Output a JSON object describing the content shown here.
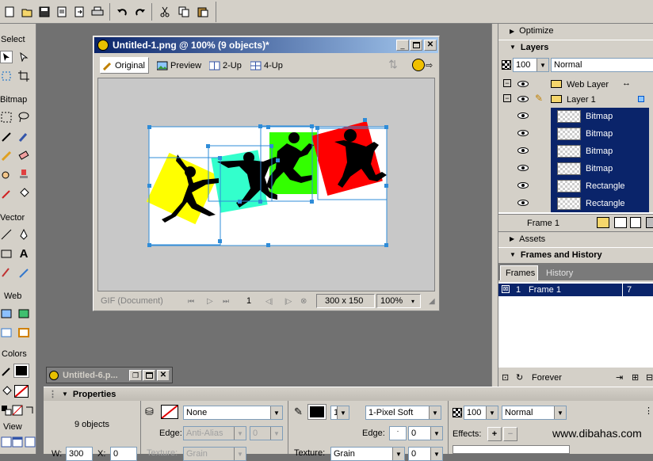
{
  "document": {
    "title": "Untitled-1.png @ 100% (9 objects)*",
    "view_tabs": [
      "Original",
      "Preview",
      "2-Up",
      "4-Up"
    ],
    "status_format": "GIF (Document)",
    "frame_number": "1",
    "dimensions": "300 x 150",
    "zoom": "100%"
  },
  "minimized_doc": {
    "title": "Untitled-6.p..."
  },
  "toolbox": {
    "sections": [
      "Select",
      "Bitmap",
      "Vector",
      "Web",
      "Colors",
      "View"
    ]
  },
  "right_panels": {
    "optimize_label": "Optimize",
    "layers_label": "Layers",
    "opacity": "100",
    "blend_mode": "Normal",
    "layers": [
      {
        "name": "Web Layer",
        "type": "layer"
      },
      {
        "name": "Layer 1",
        "type": "layer"
      },
      {
        "name": "Bitmap",
        "type": "object"
      },
      {
        "name": "Bitmap",
        "type": "object"
      },
      {
        "name": "Bitmap",
        "type": "object"
      },
      {
        "name": "Bitmap",
        "type": "object"
      },
      {
        "name": "Rectangle",
        "type": "object"
      },
      {
        "name": "Rectangle",
        "type": "object"
      }
    ],
    "frame_label": "Frame 1",
    "assets_label": "Assets",
    "frames_history_label": "Frames and History",
    "tabs": [
      "Frames",
      "History"
    ],
    "frame_row": {
      "num": "1",
      "name": "Frame 1",
      "delay": "7"
    },
    "loop_label": "Forever"
  },
  "properties": {
    "header": "Properties",
    "summary": "9 objects",
    "fill": "None",
    "edge_label": "Edge:",
    "edge_value": "Anti-Alias",
    "edge_num": "0",
    "texture_label": "Texture:",
    "texture_value": "Grain",
    "stroke_size": "1",
    "stroke_type": "1-Pixel Soft",
    "stroke_edge_label": "Edge:",
    "stroke_edge_num": "0",
    "stroke_texture_label": "Texture:",
    "stroke_texture_value": "Grain",
    "stroke_texture_num": "0",
    "opacity": "100",
    "blend": "Normal",
    "effects_label": "Effects:",
    "w_label": "W:",
    "w_value": "300",
    "x_label": "X:",
    "x_value": "0",
    "watermark": "www.dibahas.com"
  },
  "colors": {
    "selection_blue": "#0a246a",
    "yellow": "#ffff00",
    "cyan": "#33ffcc",
    "green": "#33ff00",
    "red": "#ff0000"
  }
}
